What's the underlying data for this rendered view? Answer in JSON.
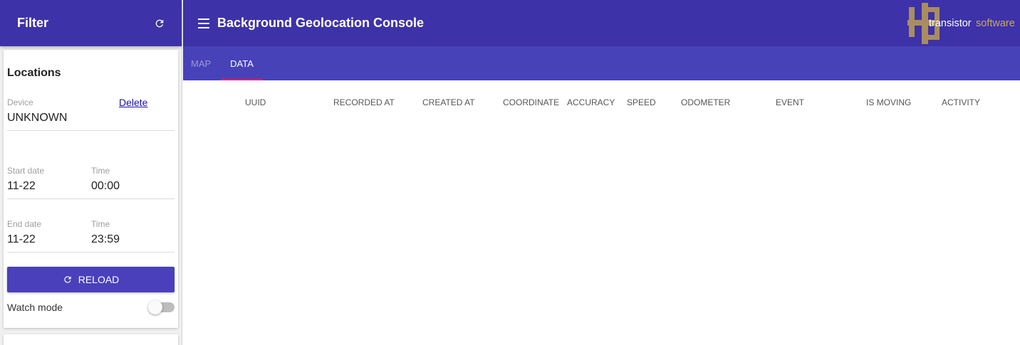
{
  "sidebar": {
    "title": "Filter",
    "card_title": "Locations",
    "device": {
      "label": "Device",
      "value": "UNKNOWN",
      "delete_label": "Delete"
    },
    "start": {
      "date_label": "Start date",
      "date_value": "11-22",
      "time_label": "Time",
      "time_value": "00:00"
    },
    "end": {
      "date_label": "End date",
      "date_value": "11-22",
      "time_label": "Time",
      "time_value": "23:59"
    },
    "reload_label": "RELOAD",
    "watch_mode_label": "Watch mode",
    "watch_mode_on": false
  },
  "header": {
    "title": "Background Geolocation Console",
    "logo_text_a": "transistor",
    "logo_text_b": "software"
  },
  "tabs": [
    {
      "label": "MAP",
      "active": false
    },
    {
      "label": "DATA",
      "active": true
    }
  ],
  "table": {
    "columns": [
      "UUID",
      "RECORDED AT",
      "CREATED AT",
      "COORDINATE",
      "ACCURACY",
      "SPEED",
      "ODOMETER",
      "EVENT",
      "IS MOVING",
      "ACTIVITY"
    ]
  },
  "colors": {
    "primary": "#3d32a8",
    "tab_bar": "#4742b8",
    "accent": "#e91e63",
    "logo_gold": "#b5975a"
  }
}
